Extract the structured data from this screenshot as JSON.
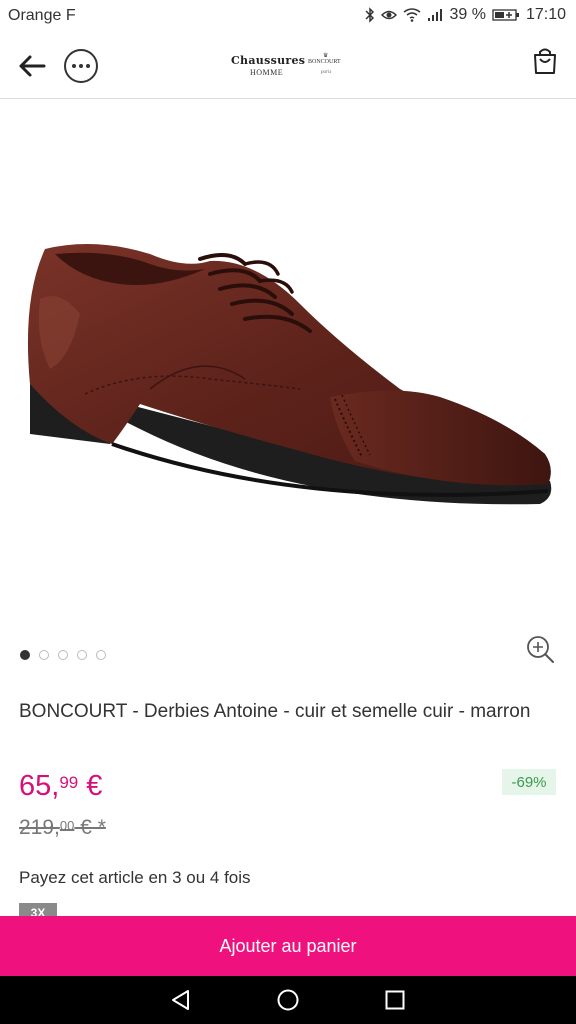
{
  "status_bar": {
    "carrier": "Orange F",
    "battery_percent": "39 %",
    "time": "17:10",
    "icons": [
      "bluetooth-icon",
      "eye-icon",
      "wifi-icon",
      "signal-icon",
      "battery-charging-icon"
    ]
  },
  "header": {
    "logo": {
      "line1": "Chaussures",
      "line2": "HOMME",
      "brand": "BONCOURT",
      "tagline": "paris"
    },
    "icons": [
      "back-arrow-icon",
      "more-dots-icon",
      "shopping-bag-icon"
    ]
  },
  "carousel": {
    "total": 5,
    "active": 0
  },
  "product": {
    "title": "BONCOURT - Derbies Antoine - cuir et semelle cuir - marron",
    "price_main": "65,",
    "price_cents": "99",
    "price_currency": " €",
    "discount": "-69%",
    "old_price_main": "219,",
    "old_price_cents": "00",
    "old_price_suffix": " € *",
    "payment_text": "Payez cet article en 3 ou 4 fois",
    "badge": "3X"
  },
  "cta": {
    "add_to_cart": "Ajouter au panier"
  },
  "colors": {
    "accent": "#ef127e",
    "price": "#d6107a",
    "discount_bg": "#e6f5e9",
    "discount_text": "#3a9a4e"
  }
}
